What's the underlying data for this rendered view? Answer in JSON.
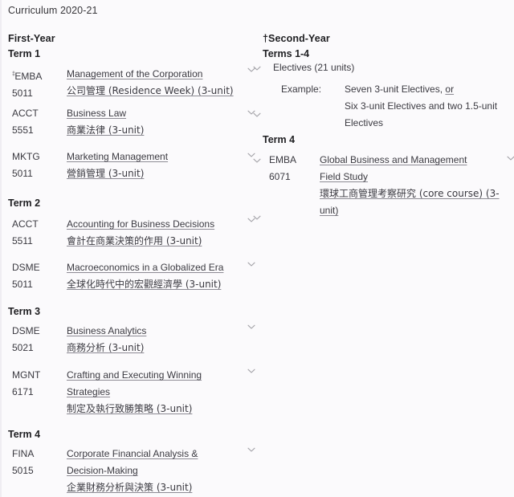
{
  "page": {
    "title": "Curriculum 2020-21",
    "background": "#fbfafc",
    "text_color": "#3b3a41"
  },
  "icons": {
    "chevron_down": "chevron-down-icon"
  },
  "left_column": {
    "year_heading": "First-Year",
    "terms": [
      {
        "heading": "Term 1",
        "courses": [
          {
            "marker": "‡",
            "code_line1": "EMBA",
            "code_line2": "5011",
            "lines": [
              "Management of the Corporation",
              "公司管理 (Residence Week) (3-unit)"
            ]
          },
          {
            "marker": "",
            "code_line1": "ACCT",
            "code_line2": "5551",
            "lines": [
              "Business Law",
              "商業法律 (3-unit)"
            ]
          },
          {
            "marker": "",
            "code_line1": "MKTG",
            "code_line2": "5011",
            "lines": [
              "Marketing Management",
              "營銷管理 (3-unit)"
            ]
          }
        ]
      },
      {
        "heading": "Term 2",
        "courses": [
          {
            "marker": "",
            "code_line1": "ACCT",
            "code_line2": "5511",
            "lines": [
              "Accounting for Business Decisions",
              "會計在商業決策的作用 (3-unit)"
            ]
          },
          {
            "marker": "",
            "code_line1": "DSME",
            "code_line2": "5011",
            "lines": [
              "Macroeconomics in a Globalized Era",
              "全球化時代中的宏觀經濟學 (3-unit)"
            ]
          }
        ]
      },
      {
        "heading": "Term 3",
        "courses": [
          {
            "marker": "",
            "code_line1": "DSME",
            "code_line2": "5021",
            "lines": [
              "Business Analytics",
              "商務分析 (3-unit)"
            ]
          },
          {
            "marker": "",
            "code_line1": "MGNT",
            "code_line2": "6171",
            "lines": [
              "Crafting and Executing Winning",
              "Strategies",
              "制定及執行致勝策略 (3-unit)"
            ]
          }
        ]
      },
      {
        "heading": "Term 4",
        "courses": [
          {
            "marker": "",
            "code_line1": "FINA",
            "code_line2": "5015",
            "lines": [
              "Corporate Financial Analysis &",
              "Decision-Making",
              "企業財務分析與決策 (3-unit)"
            ]
          }
        ]
      }
    ]
  },
  "right_column": {
    "year_heading": "†Second-Year",
    "terms_heading": "Terms 1-4",
    "electives_label": "Electives (21 units)",
    "example_label": "Example:",
    "example_lines": [
      "Seven 3-unit Electives, or",
      "Six 3-unit Electives and two 1.5-unit",
      "Electives"
    ],
    "example_underlined_word": "or",
    "term_heading": "Term 4",
    "course": {
      "code_line1": "EMBA",
      "code_line2": "6071",
      "lines": [
        "Global Business and Management",
        "Field Study",
        "環球工商管理考察研究 (core course) (3-",
        "unit)"
      ]
    }
  }
}
